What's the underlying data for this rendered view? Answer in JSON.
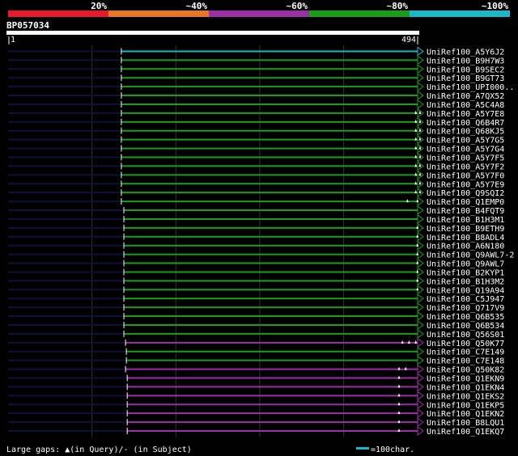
{
  "identity_legend": {
    "labels": [
      "20%",
      "~40%",
      "~60%",
      "~80%",
      "~100%"
    ],
    "colors": [
      "#e8192c",
      "#e87722",
      "#9b2fa5",
      "#1a9e1a",
      "#19b8c8"
    ]
  },
  "query": {
    "id": "BP057034",
    "start_label": "1",
    "end_label": "494",
    "length": 494
  },
  "hits": [
    {
      "name": "UniRef100_A5Y6J2",
      "color": "#19b8c8",
      "start": 135
    },
    {
      "name": "UniRef100_B9H7W3",
      "color": "#1a9e1a",
      "start": 135
    },
    {
      "name": "UniRef100_B9SEC2",
      "color": "#1a9e1a",
      "start": 135
    },
    {
      "name": "UniRef100_B9GT73",
      "color": "#1a9e1a",
      "start": 135
    },
    {
      "name": "UniRef100_UPI000..",
      "color": "#1a9e1a",
      "start": 135
    },
    {
      "name": "UniRef100_A7QX52",
      "color": "#1a9e1a",
      "start": 135
    },
    {
      "name": "UniRef100_A5C4A8",
      "color": "#1a9e1a",
      "start": 135
    },
    {
      "name": "UniRef100_A5Y7E8",
      "color": "#1a9e1a",
      "start": 135,
      "gaps": [
        486,
        491
      ]
    },
    {
      "name": "UniRef100_Q6B4R7",
      "color": "#1a9e1a",
      "start": 135,
      "gaps": [
        486,
        491
      ]
    },
    {
      "name": "UniRef100_Q68KJ5",
      "color": "#1a9e1a",
      "start": 135,
      "gaps": [
        486,
        491
      ]
    },
    {
      "name": "UniRef100_A5Y7G5",
      "color": "#1a9e1a",
      "start": 135,
      "gaps": [
        486,
        491
      ]
    },
    {
      "name": "UniRef100_A5Y7G4",
      "color": "#1a9e1a",
      "start": 135,
      "gaps": [
        486,
        491
      ]
    },
    {
      "name": "UniRef100_A5Y7F5",
      "color": "#1a9e1a",
      "start": 135,
      "gaps": [
        486,
        491
      ]
    },
    {
      "name": "UniRef100_A5Y7F2",
      "color": "#1a9e1a",
      "start": 135,
      "gaps": [
        486,
        491
      ]
    },
    {
      "name": "UniRef100_A5Y7F0",
      "color": "#1a9e1a",
      "start": 135,
      "gaps": [
        486,
        491
      ]
    },
    {
      "name": "UniRef100_A5Y7E9",
      "color": "#1a9e1a",
      "start": 135,
      "gaps": [
        486,
        491
      ]
    },
    {
      "name": "UniRef100_Q9SQI2",
      "color": "#1a9e1a",
      "start": 135,
      "gaps": [
        486,
        491
      ]
    },
    {
      "name": "UniRef100_Q1EMP0",
      "color": "#1a9e1a",
      "start": 135,
      "gaps": [
        476,
        488
      ]
    },
    {
      "name": "UniRef100_B4FQT9",
      "color": "#1a9e1a",
      "start": 138
    },
    {
      "name": "UniRef100_B1H3M1",
      "color": "#1a9e1a",
      "start": 138
    },
    {
      "name": "UniRef100_B9ETH9",
      "color": "#1a9e1a",
      "start": 138,
      "gaps": [
        488
      ]
    },
    {
      "name": "UniRef100_B8ADL4",
      "color": "#1a9e1a",
      "start": 138,
      "gaps": [
        488
      ]
    },
    {
      "name": "UniRef100_A6N180",
      "color": "#1a9e1a",
      "start": 138,
      "gaps": [
        488
      ]
    },
    {
      "name": "UniRef100_Q9AWL7-2",
      "color": "#1a9e1a",
      "start": 138,
      "gaps": [
        488
      ]
    },
    {
      "name": "UniRef100_Q9AWL7",
      "color": "#1a9e1a",
      "start": 138,
      "gaps": [
        488
      ]
    },
    {
      "name": "UniRef100_B2KYP1",
      "color": "#1a9e1a",
      "start": 138,
      "gaps": [
        488
      ]
    },
    {
      "name": "UniRef100_B1H3M2",
      "color": "#1a9e1a",
      "start": 138,
      "gaps": [
        488
      ]
    },
    {
      "name": "UniRef100_Q19A94",
      "color": "#1a9e1a",
      "start": 138,
      "gaps": [
        488
      ]
    },
    {
      "name": "UniRef100_C5J947",
      "color": "#1a9e1a",
      "start": 138
    },
    {
      "name": "UniRef100_Q717V9",
      "color": "#1a9e1a",
      "start": 138
    },
    {
      "name": "UniRef100_Q6B535",
      "color": "#1a9e1a",
      "start": 138
    },
    {
      "name": "UniRef100_Q6B534",
      "color": "#1a9e1a",
      "start": 138
    },
    {
      "name": "UniRef100_Q56S01",
      "color": "#1a9e1a",
      "start": 138
    },
    {
      "name": "UniRef100_Q50K77",
      "color": "#9b2fa5",
      "start": 140,
      "gaps": [
        470,
        478,
        486
      ]
    },
    {
      "name": "UniRef100_C7E149",
      "color": "#1a9e1a",
      "start": 141
    },
    {
      "name": "UniRef100_C7E148",
      "color": "#1a9e1a",
      "start": 141
    },
    {
      "name": "UniRef100_Q50K82",
      "color": "#9b2fa5",
      "start": 140,
      "gaps": [
        466,
        474
      ]
    },
    {
      "name": "UniRef100_Q1EKN9",
      "color": "#9b2fa5",
      "start": 142,
      "gaps": [
        466
      ]
    },
    {
      "name": "UniRef100_Q1EKN4",
      "color": "#9b2fa5",
      "start": 142,
      "gaps": [
        466
      ]
    },
    {
      "name": "UniRef100_Q1EKS2",
      "color": "#9b2fa5",
      "start": 142,
      "gaps": [
        466
      ]
    },
    {
      "name": "UniRef100_Q1EKP5",
      "color": "#9b2fa5",
      "start": 142,
      "gaps": [
        466
      ]
    },
    {
      "name": "UniRef100_Q1EKN2",
      "color": "#9b2fa5",
      "start": 142,
      "gaps": [
        466
      ]
    },
    {
      "name": "UniRef100_B8LQU1",
      "color": "#9b2fa5",
      "start": 142,
      "gaps": [
        466
      ]
    },
    {
      "name": "UniRef100_Q1EKQ7",
      "color": "#9b2fa5",
      "start": 142,
      "gaps": [
        466
      ]
    }
  ],
  "footer": {
    "gaps_label": "Large gaps: ▲(in Query)/- (in Subject)",
    "scale_label": "=100char.",
    "scale_color": "#19b8c8"
  }
}
